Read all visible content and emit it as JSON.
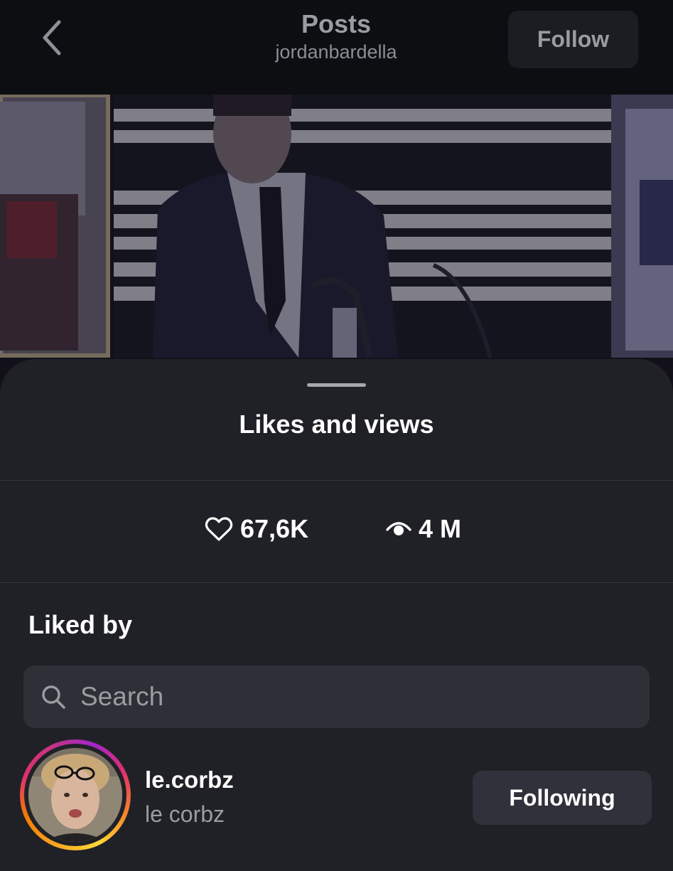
{
  "header": {
    "title": "Posts",
    "subtitle": "jordanbardella",
    "back_icon": "chevron-left-icon",
    "follow_label": "Follow"
  },
  "sheet": {
    "title": "Likes and views",
    "stats": {
      "likes_icon": "heart-outline-icon",
      "likes": "67,6K",
      "views_icon": "eye-icon",
      "views": "4 M"
    },
    "liked_by_label": "Liked by",
    "search": {
      "icon": "search-icon",
      "placeholder": "Search",
      "value": ""
    },
    "users": [
      {
        "username": "le.corbz",
        "full_name": "le corbz",
        "button_label": "Following",
        "story_ring": true
      }
    ]
  },
  "colors": {
    "background": "#000000",
    "topbar": "#0d0e12",
    "sheet": "#202126",
    "search_field": "#2f3037",
    "secondary_button": "#30313a",
    "muted_text": "#9b9ca2"
  }
}
